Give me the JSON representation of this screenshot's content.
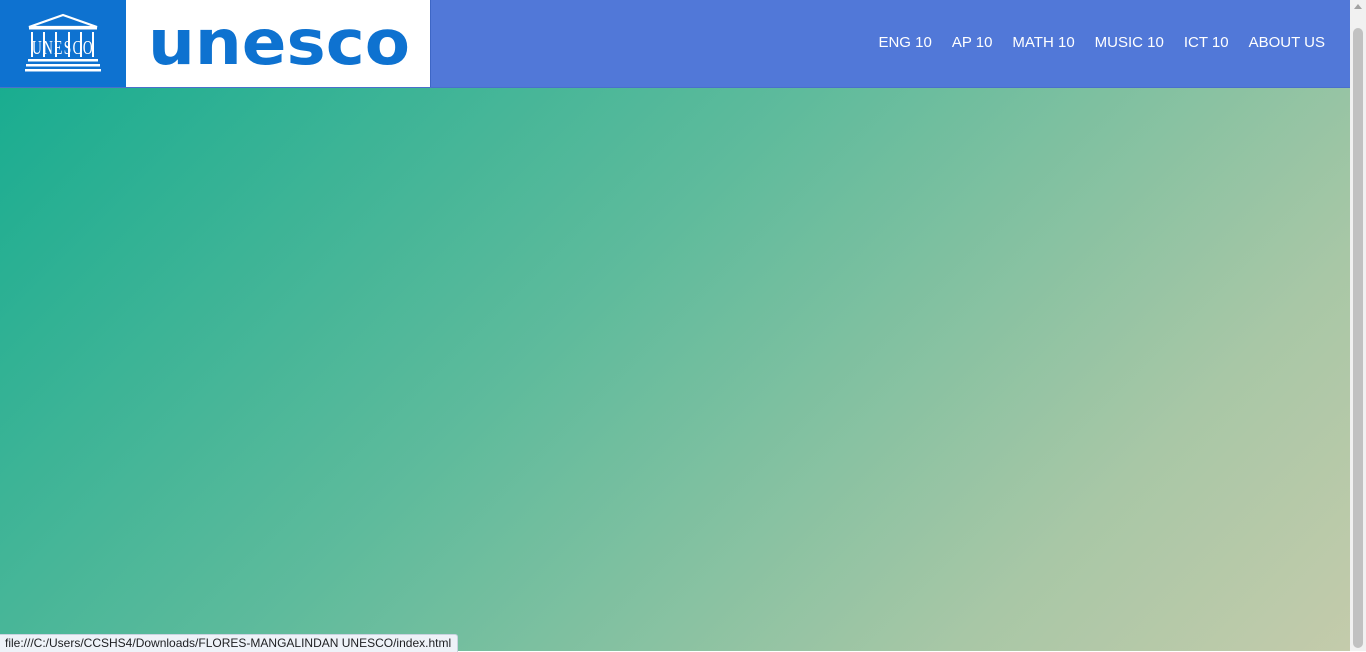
{
  "header": {
    "logo_wordmark": "unesco",
    "emblem_text": "UNESCO",
    "nav_items": [
      {
        "label": "ENG 10"
      },
      {
        "label": "AP 10"
      },
      {
        "label": "MATH 10"
      },
      {
        "label": "MUSIC 10"
      },
      {
        "label": "ICT 10"
      },
      {
        "label": "ABOUT US"
      }
    ]
  },
  "status_bar": {
    "url": "file:///C:/Users/CCSHS4/Downloads/FLORES-MANGALINDAN UNESCO/index.html"
  },
  "colors": {
    "header_bg": "#5178d8",
    "emblem_bg": "#0e72d0",
    "wordmark": "#0e72d0",
    "gradient_start": "#12ab8f",
    "gradient_end": "#c4cbab"
  },
  "icons": {
    "emblem": "unesco-temple-icon"
  }
}
